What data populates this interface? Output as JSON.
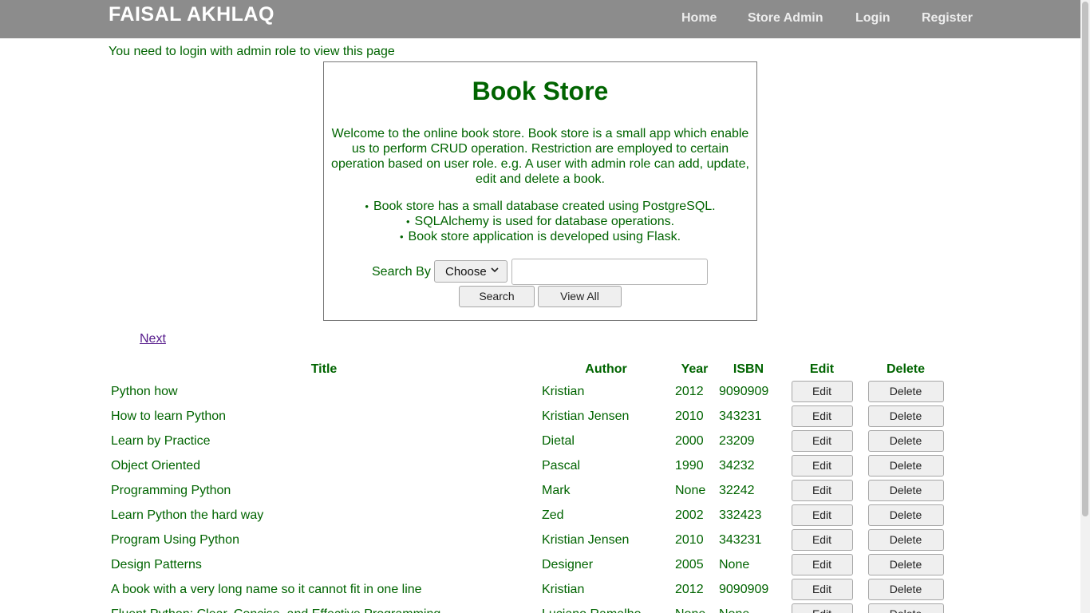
{
  "navbar": {
    "brand": "FAISAL AKHLAQ",
    "links": [
      "Home",
      "Store Admin",
      "Login",
      "Register"
    ]
  },
  "notice": "You need to login with admin role to view this page",
  "info": {
    "title": "Book Store",
    "welcome": "Welcome to the online book store. Book store is a small app which enable us to perform CRUD operation. Restriction are employed to certain operation based on user role. e.g. A user with admin role can add, update, edit and delete a book.",
    "features": [
      "Book store has a small database created using PostgreSQL.",
      "SQLAlchemy is used for database operations.",
      "Book store application is developed using Flask."
    ]
  },
  "search": {
    "label": "Search By",
    "select_value": "Choose",
    "input_value": "",
    "search_button": "Search",
    "view_all_button": "View All"
  },
  "pagination": {
    "next": "Next"
  },
  "table": {
    "headers": [
      "Title",
      "Author",
      "Year",
      "ISBN",
      "Edit",
      "Delete"
    ],
    "edit_label": "Edit",
    "delete_label": "Delete",
    "rows": [
      {
        "title": "Python how",
        "author": "Kristian",
        "year": "2012",
        "isbn": "9090909"
      },
      {
        "title": "How to learn Python",
        "author": "Kristian Jensen",
        "year": "2010",
        "isbn": "343231"
      },
      {
        "title": "Learn by Practice",
        "author": "Dietal",
        "year": "2000",
        "isbn": "23209"
      },
      {
        "title": "Object Oriented",
        "author": "Pascal",
        "year": "1990",
        "isbn": "34232"
      },
      {
        "title": "Programming Python",
        "author": "Mark",
        "year": "None",
        "isbn": "32242"
      },
      {
        "title": "Learn Python the hard way",
        "author": "Zed",
        "year": "2002",
        "isbn": "332423"
      },
      {
        "title": "Program Using Python",
        "author": "Kristian Jensen",
        "year": "2010",
        "isbn": "343231"
      },
      {
        "title": "Design Patterns",
        "author": "Designer",
        "year": "2005",
        "isbn": "None"
      },
      {
        "title": "A book with a very long name so it cannot fit in one line",
        "author": "Kristian",
        "year": "2012",
        "isbn": "9090909"
      },
      {
        "title": "Fluent Python: Clear, Concise, and Effective Programming",
        "author": "Luciano Ramalho",
        "year": "None",
        "isbn": "None"
      }
    ]
  }
}
